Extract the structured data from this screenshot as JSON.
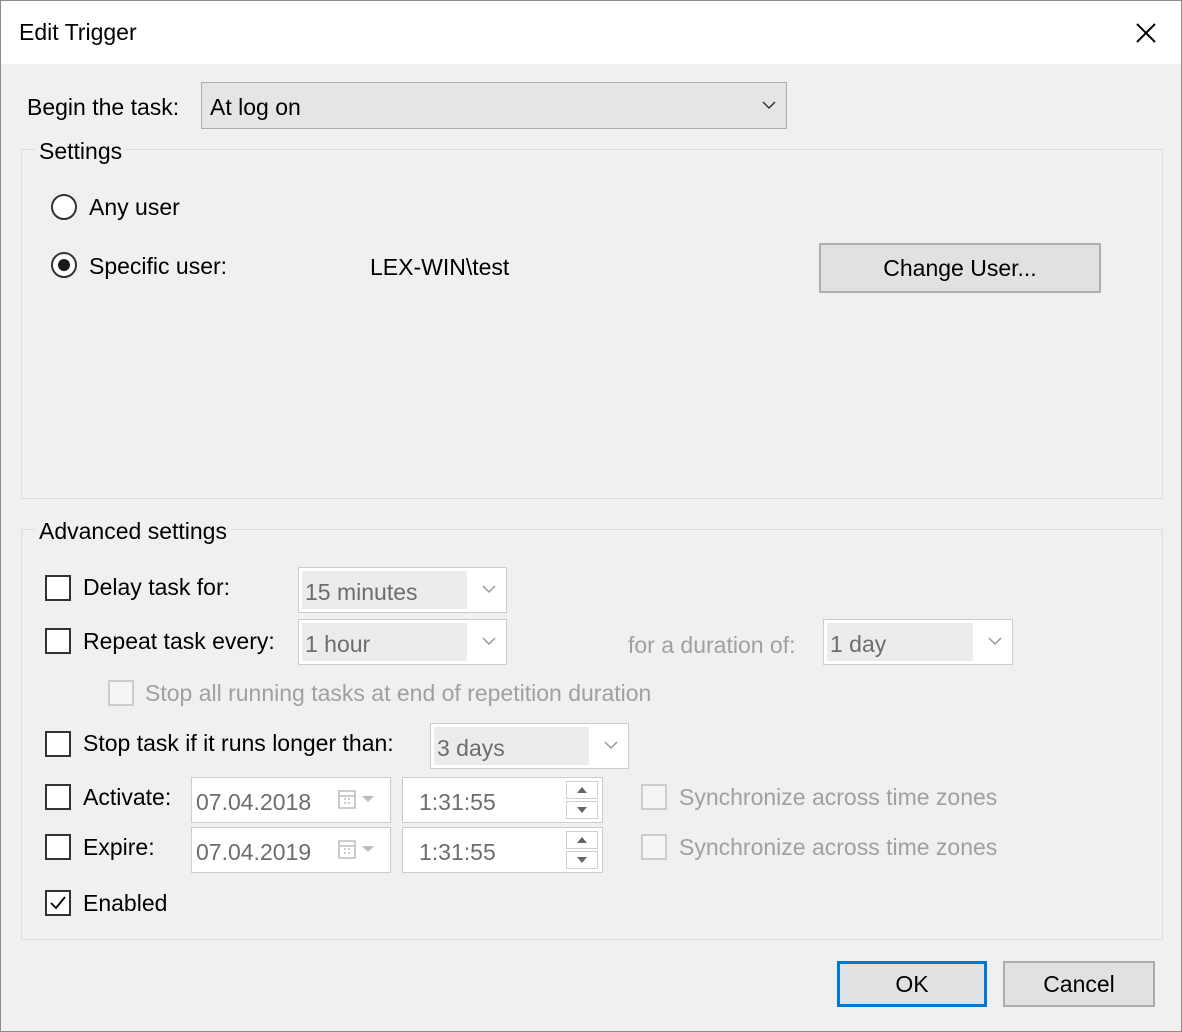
{
  "window": {
    "title": "Edit Trigger"
  },
  "begin": {
    "label": "Begin the task:",
    "value": "At log on"
  },
  "settings": {
    "legend": "Settings",
    "any_user_label": "Any user",
    "specific_user_label": "Specific user:",
    "user_value": "LEX-WIN\\test",
    "change_user_button": "Change User...",
    "selected": "specific_user"
  },
  "advanced": {
    "legend": "Advanced settings",
    "delay": {
      "label": "Delay task for:",
      "value": "15 minutes",
      "checked": false
    },
    "repeat": {
      "label": "Repeat task every:",
      "value": "1 hour",
      "checked": false,
      "duration_label": "for a duration of:",
      "duration_value": "1 day"
    },
    "stop_all": {
      "label": "Stop all running tasks at end of repetition duration",
      "checked": false
    },
    "stop_if": {
      "label": "Stop task if it runs longer than:",
      "value": "3 days",
      "checked": false
    },
    "activate": {
      "label": "Activate:",
      "date": "07.04.2018",
      "time": "1:31:55",
      "sync_label": "Synchronize across time zones",
      "checked": false
    },
    "expire": {
      "label": "Expire:",
      "date": "07.04.2019",
      "time": "1:31:55",
      "sync_label": "Synchronize across time zones",
      "checked": false
    },
    "enabled": {
      "label": "Enabled",
      "checked": true
    }
  },
  "buttons": {
    "ok": "OK",
    "cancel": "Cancel"
  }
}
